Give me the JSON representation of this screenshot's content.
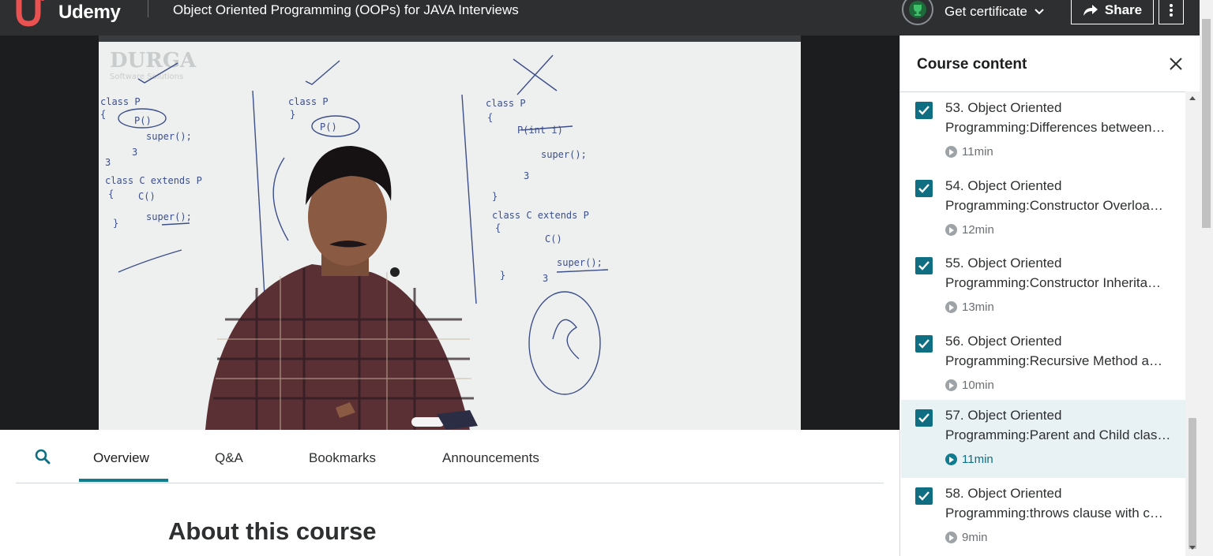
{
  "header": {
    "logo_text": "Udemy",
    "course_title": "Object Oriented Programming (OOPs) for JAVA Interviews",
    "certificate_label": "Get certificate",
    "share_label": "Share"
  },
  "video": {
    "watermark_title": "DURGA",
    "watermark_sub": "Software Solutions"
  },
  "tabs": [
    {
      "label": "Overview",
      "active": true
    },
    {
      "label": "Q&A",
      "active": false
    },
    {
      "label": "Bookmarks",
      "active": false
    },
    {
      "label": "Announcements",
      "active": false
    }
  ],
  "main": {
    "about_heading": "About this course"
  },
  "sidebar": {
    "title": "Course content",
    "lessons": [
      {
        "line1": "53. Object Oriented",
        "line2": "Programming:Differences between…",
        "duration": "11min",
        "completed": true,
        "current": false
      },
      {
        "line1": "54. Object Oriented",
        "line2": "Programming:Constructor Overloa…",
        "duration": "12min",
        "completed": true,
        "current": false
      },
      {
        "line1": "55. Object Oriented",
        "line2": "Programming:Constructor Inherita…",
        "duration": "13min",
        "completed": true,
        "current": false
      },
      {
        "line1": "56. Object Oriented",
        "line2": "Programming:Recursive Method a…",
        "duration": "10min",
        "completed": true,
        "current": false
      },
      {
        "line1": "57. Object Oriented",
        "line2": "Programming:Parent and Child clas…",
        "duration": "11min",
        "completed": true,
        "current": true
      },
      {
        "line1": "58. Object Oriented",
        "line2": "Programming:throws clause with c…",
        "duration": "9min",
        "completed": true,
        "current": false
      }
    ]
  },
  "colors": {
    "header_bg": "#2d2f31",
    "accent": "#0f7c90",
    "checkbox": "#0f6e82",
    "logo_red": "#ea5252",
    "current_row_bg": "#e8f2f5"
  }
}
